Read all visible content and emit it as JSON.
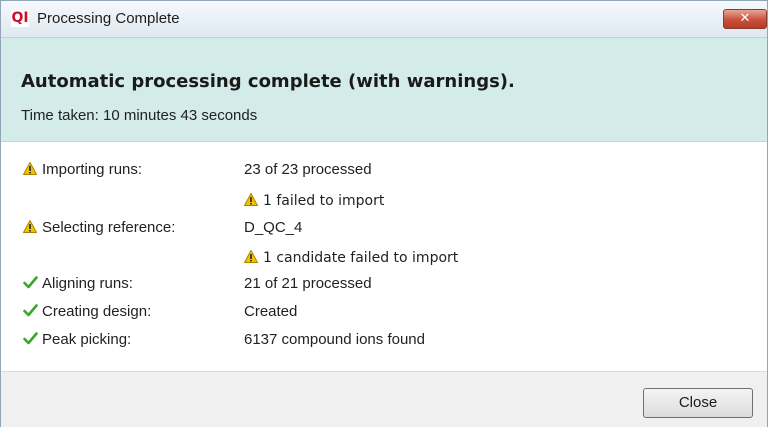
{
  "window": {
    "title": "Processing Complete",
    "app_icon_text": "QI",
    "close_glyph": "✕"
  },
  "header": {
    "headline": "Automatic processing complete (with warnings).",
    "time_taken": "Time taken: 10 minutes 43 seconds"
  },
  "steps": [
    {
      "status": "warning",
      "label": "Importing runs:",
      "value": "23 of 23 processed",
      "note": "1 failed to import"
    },
    {
      "status": "warning",
      "label": "Selecting reference:",
      "value": "D_QC_4",
      "note": "1 candidate failed to import"
    },
    {
      "status": "success",
      "label": "Aligning runs:",
      "value": "21 of 21 processed"
    },
    {
      "status": "success",
      "label": "Creating design:",
      "value": "Created"
    },
    {
      "status": "success",
      "label": "Peak picking:",
      "value": "6137 compound ions found"
    }
  ],
  "footer": {
    "close_label": "Close"
  },
  "colors": {
    "header_band": "#d3ebe9",
    "warning_icon": "#f2c200",
    "success_icon": "#3aa52a",
    "title_close": "#c9503b"
  },
  "icons": {
    "warning": "warning-triangle-icon",
    "success": "checkmark-icon"
  }
}
